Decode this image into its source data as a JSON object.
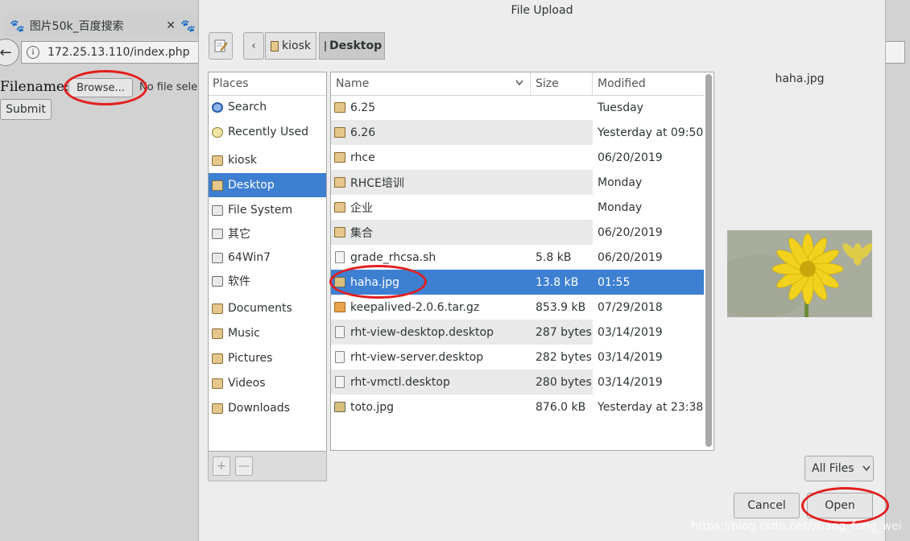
{
  "colors": {
    "accent": "#3d7fd1",
    "annotation": "#e41e1e"
  },
  "browser": {
    "tabs": [
      {
        "label": "图片50k_百度搜索",
        "icon": "paw-icon",
        "close": "✕"
      },
      {
        "label": "",
        "icon": "paw-icon"
      }
    ],
    "url": "172.25.13.110/index.php"
  },
  "page": {
    "filename_label": "Filename:",
    "browse_label": "Browse...",
    "no_file_text": "No file sele",
    "submit_label": "Submit"
  },
  "dialog": {
    "title": "File Upload",
    "breadcrumb": [
      "kiosk",
      "Desktop"
    ],
    "places_header": "Places",
    "places": [
      {
        "label": "Search",
        "icon": "search-icon"
      },
      {
        "label": "Recently Used",
        "icon": "clock-icon"
      },
      {
        "label": "kiosk",
        "icon": "home-folder-icon"
      },
      {
        "label": "Desktop",
        "icon": "desktop-folder-icon",
        "active": true
      },
      {
        "label": "File System",
        "icon": "drive-icon"
      },
      {
        "label": "其它",
        "icon": "drive-icon"
      },
      {
        "label": "64Win7",
        "icon": "drive-icon"
      },
      {
        "label": "软件",
        "icon": "drive-icon"
      },
      {
        "label": "Documents",
        "icon": "folder-icon"
      },
      {
        "label": "Music",
        "icon": "folder-icon"
      },
      {
        "label": "Pictures",
        "icon": "folder-icon"
      },
      {
        "label": "Videos",
        "icon": "folder-icon"
      },
      {
        "label": "Downloads",
        "icon": "folder-icon"
      }
    ],
    "add_label": "+",
    "remove_label": "—",
    "columns": {
      "name": "Name",
      "size": "Size",
      "modified": "Modified"
    },
    "files": [
      {
        "name": "6.25",
        "size": "",
        "modified": "Tuesday",
        "icon": "folder-icon"
      },
      {
        "name": "6.26",
        "size": "",
        "modified": "Yesterday at 09:50",
        "icon": "folder-icon"
      },
      {
        "name": "rhce",
        "size": "",
        "modified": "06/20/2019",
        "icon": "folder-icon"
      },
      {
        "name": "RHCE培训",
        "size": "",
        "modified": "Monday",
        "icon": "folder-icon"
      },
      {
        "name": "企业",
        "size": "",
        "modified": "Monday",
        "icon": "folder-icon"
      },
      {
        "name": "集合",
        "size": "",
        "modified": "06/20/2019",
        "icon": "folder-icon"
      },
      {
        "name": "grade_rhcsa.sh",
        "size": "5.8 kB",
        "modified": "06/20/2019",
        "icon": "script-icon"
      },
      {
        "name": "haha.jpg",
        "size": "13.8 kB",
        "modified": "01:55",
        "icon": "image-icon",
        "selected": true
      },
      {
        "name": "keepalived-2.0.6.tar.gz",
        "size": "853.9 kB",
        "modified": "07/29/2018",
        "icon": "archive-icon"
      },
      {
        "name": "rht-view-desktop.desktop",
        "size": "287 bytes",
        "modified": "03/14/2019",
        "icon": "document-icon"
      },
      {
        "name": "rht-view-server.desktop",
        "size": "282 bytes",
        "modified": "03/14/2019",
        "icon": "document-icon"
      },
      {
        "name": "rht-vmctl.desktop",
        "size": "280 bytes",
        "modified": "03/14/2019",
        "icon": "document-icon"
      },
      {
        "name": "toto.jpg",
        "size": "876.0 kB",
        "modified": "Yesterday at 23:38",
        "icon": "image-icon"
      }
    ],
    "preview_name": "haha.jpg",
    "filter_label": "All Files",
    "cancel_label": "Cancel",
    "open_label": "Open"
  },
  "watermark": "https://blog.csdn.net/zhang_feng_wei"
}
